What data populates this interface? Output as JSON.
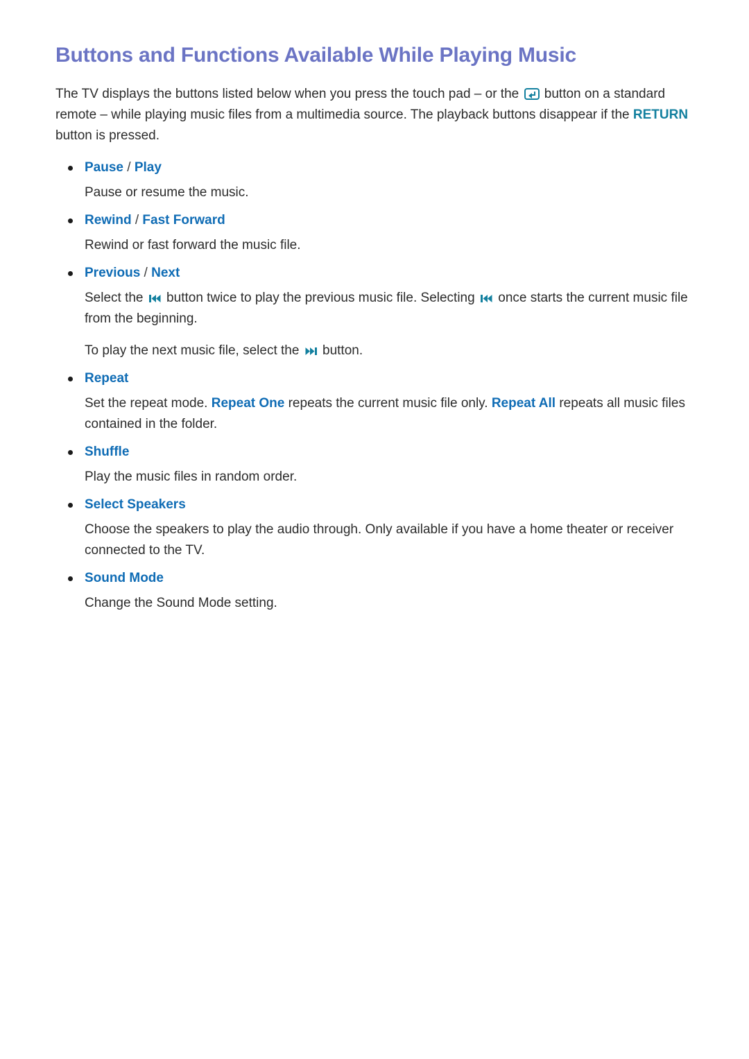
{
  "page": {
    "title": "Buttons and Functions Available While Playing Music",
    "intro": {
      "part1": "The TV displays the buttons listed below when you press the touch pad – or the ",
      "enter_icon": "enter-button-icon",
      "part2": " button on a standard remote – while playing music files from a multimedia source. The playback buttons disappear if the ",
      "return_keyword": "RETURN",
      "part3": " button is pressed."
    }
  },
  "sections": [
    {
      "id": "pause-play",
      "heading_a": "Pause",
      "separator": " / ",
      "heading_b": "Play",
      "body": "Pause or resume the music."
    },
    {
      "id": "rewind-fast-forward",
      "heading_a": "Rewind",
      "separator": " / ",
      "heading_b": "Fast Forward",
      "body": "Rewind or fast forward the music file."
    },
    {
      "id": "previous-next",
      "heading_a": "Previous",
      "separator": " / ",
      "heading_b": "Next",
      "body_1_part1": "Select the ",
      "body_1_icon1": "skip-previous-icon",
      "body_1_part2": " button twice to play the previous music file. Selecting ",
      "body_1_icon2": "skip-previous-icon",
      "body_1_part3": " once starts the current music file from the beginning.",
      "body_2_part1": "To play the next music file, select the ",
      "body_2_icon": "skip-next-icon",
      "body_2_part2": " button."
    },
    {
      "id": "repeat",
      "heading_a": "Repeat",
      "body_part1": "Set the repeat mode. ",
      "body_kw1": "Repeat One",
      "body_part2": " repeats the current music file only. ",
      "body_kw2": "Repeat All",
      "body_part3": " repeats all music files contained in the folder."
    },
    {
      "id": "shuffle",
      "heading_a": "Shuffle",
      "body": "Play the music files in random order."
    },
    {
      "id": "select-speakers",
      "heading_a": "Select Speakers",
      "body": "Choose the speakers to play the audio through. Only available if you have a home theater or receiver connected to the TV."
    },
    {
      "id": "sound-mode",
      "heading_a": "Sound Mode",
      "body": "Change the Sound Mode setting."
    }
  ],
  "colors": {
    "title": "#6b74c4",
    "keyword_blue": "#0f6cb5",
    "keyword_teal": "#13809f",
    "body_text": "#2b2b2b",
    "background": "#ffffff"
  }
}
